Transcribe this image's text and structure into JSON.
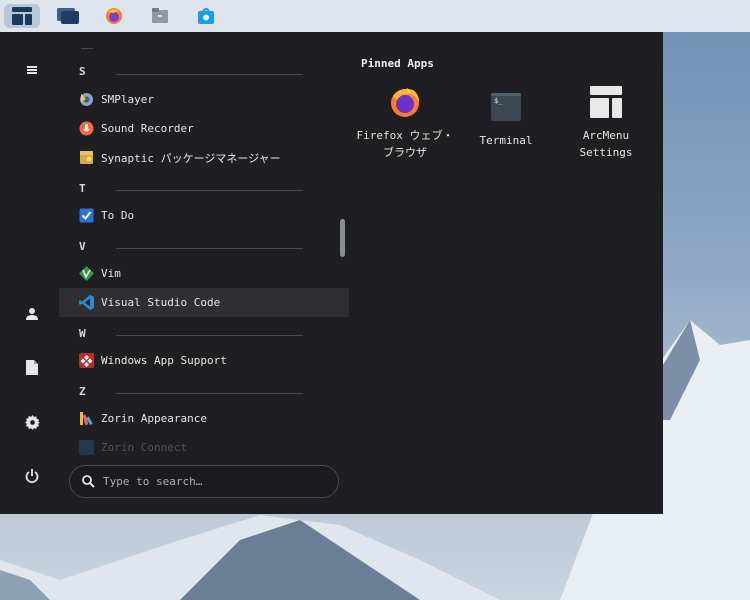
{
  "taskbar": {
    "items": [
      {
        "icon": "arcmenu-layout-icon",
        "active": true
      },
      {
        "icon": "window-overview-icon"
      },
      {
        "icon": "firefox-icon"
      },
      {
        "icon": "files-icon"
      },
      {
        "icon": "software-store-icon"
      }
    ]
  },
  "rail": {
    "items": [
      {
        "icon": "hamburger-menu-icon"
      },
      {
        "icon": "user-icon"
      },
      {
        "icon": "document-icon"
      },
      {
        "icon": "settings-gear-icon"
      },
      {
        "icon": "power-icon"
      }
    ]
  },
  "applist": {
    "sections": [
      {
        "letter": "S"
      },
      {
        "letter": "T"
      },
      {
        "letter": "V"
      },
      {
        "letter": "W"
      },
      {
        "letter": "Z"
      }
    ],
    "apps": [
      {
        "label": "SMPlayer",
        "icon": "smplayer-icon"
      },
      {
        "label": "Sound Recorder",
        "icon": "microphone-icon"
      },
      {
        "label": "Synaptic パッケージマネージャー",
        "icon": "synaptic-package-icon"
      },
      {
        "label": "To Do",
        "icon": "checkbox-icon"
      },
      {
        "label": "Vim",
        "icon": "vim-icon"
      },
      {
        "label": "Visual Studio Code",
        "icon": "vscode-icon",
        "highlighted": true
      },
      {
        "label": "Windows App Support",
        "icon": "wine-icon"
      },
      {
        "label": "Zorin Appearance",
        "icon": "brushes-icon"
      },
      {
        "label": "Zorin Connect",
        "icon": "phone-icon"
      }
    ]
  },
  "search": {
    "placeholder": "Type to search…"
  },
  "pinned": {
    "title": "Pinned Apps",
    "apps": [
      {
        "label": "Firefox ウェブ・ブラウザ",
        "icon": "firefox-icon"
      },
      {
        "label": "Terminal",
        "icon": "terminal-icon"
      },
      {
        "label": "ArcMenu Settings",
        "icon": "arcmenu-layout-icon"
      }
    ]
  },
  "colors": {
    "menu_bg": "#1f1f21",
    "highlight": "#2f2f31",
    "taskbar_bg": "#dfe5ec",
    "accent": "#2a8bd6"
  }
}
